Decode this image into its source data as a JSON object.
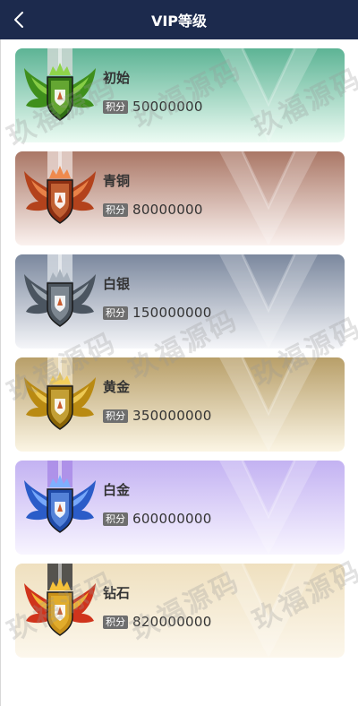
{
  "header": {
    "title": "VIP等级",
    "back_icon": "chevron-left-icon"
  },
  "points_badge_label": "积分",
  "watermark_text": "玖福源码",
  "levels": [
    {
      "name": "初始",
      "points": "50000000",
      "medal_icon": "green-winged-shield-medal-icon",
      "top": "#5db495",
      "bottom": "#ecfbf3",
      "wing": "#3f8f1c",
      "wing_hi": "#8fd44a",
      "shield": "#2f6f14",
      "ribbon": "#cfd8d4"
    },
    {
      "name": "青铜",
      "points": "80000000",
      "medal_icon": "bronze-winged-shield-medal-icon",
      "top": "#aa7766",
      "bottom": "#fbf2ef",
      "wing": "#b3421c",
      "wing_hi": "#ee8a4e",
      "shield": "#8a2e12",
      "ribbon": "#e6d5cf"
    },
    {
      "name": "白银",
      "points": "150000000",
      "medal_icon": "silver-winged-shield-medal-icon",
      "top": "#7b889e",
      "bottom": "#f5f6f9",
      "wing": "#4b5560",
      "wing_hi": "#a8b2bd",
      "shield": "#4a535c",
      "ribbon": "#d4d9e1"
    },
    {
      "name": "黄金",
      "points": "350000000",
      "medal_icon": "gold-winged-shield-medal-icon",
      "top": "#b89f69",
      "bottom": "#fbf5e4",
      "wing": "#b98a12",
      "wing_hi": "#f3cf5c",
      "shield": "#8a6506",
      "ribbon": "#ecdfbf"
    },
    {
      "name": "白金",
      "points": "600000000",
      "medal_icon": "blue-winged-shield-medal-icon",
      "top": "#c3b2f2",
      "bottom": "#f8f5ff",
      "wing": "#2b5cc8",
      "wing_hi": "#7fb0ff",
      "shield": "#1f4aa8",
      "ribbon": "#a98be6"
    },
    {
      "name": "钻石",
      "points": "820000000",
      "medal_icon": "red-gold-winged-shield-medal-icon",
      "top": "#efe0bf",
      "bottom": "#fcf7ec",
      "wing": "#d0341c",
      "wing_hi": "#f6c23a",
      "shield": "#c8901a",
      "ribbon": "#3a3a3a"
    }
  ]
}
